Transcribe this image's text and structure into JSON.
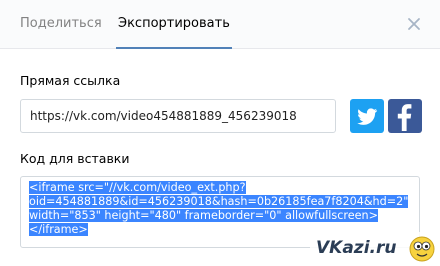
{
  "tabs": {
    "share": "Поделиться",
    "export": "Экспортировать"
  },
  "direct_link": {
    "label": "Прямая ссылка",
    "value": "https://vk.com/video454881889_456239018"
  },
  "embed": {
    "label": "Код для вставки",
    "lines": [
      "<iframe src=\"//vk.com/video_ext.php?",
      "oid=454881889&id=456239018&hash=0b26185fea7f8204&hd=2\"",
      "width=\"853\" height=\"480\" frameborder=\"0\" allowfullscreen>",
      "</iframe>"
    ]
  },
  "social": {
    "twitter_icon": "twitter-icon",
    "facebook_icon": "facebook-icon"
  },
  "watermark": "VKazi.ru",
  "colors": {
    "accent": "#5181b8",
    "twitter": "#1da1f2",
    "facebook": "#3b5998",
    "selection": "#3b85ff"
  }
}
